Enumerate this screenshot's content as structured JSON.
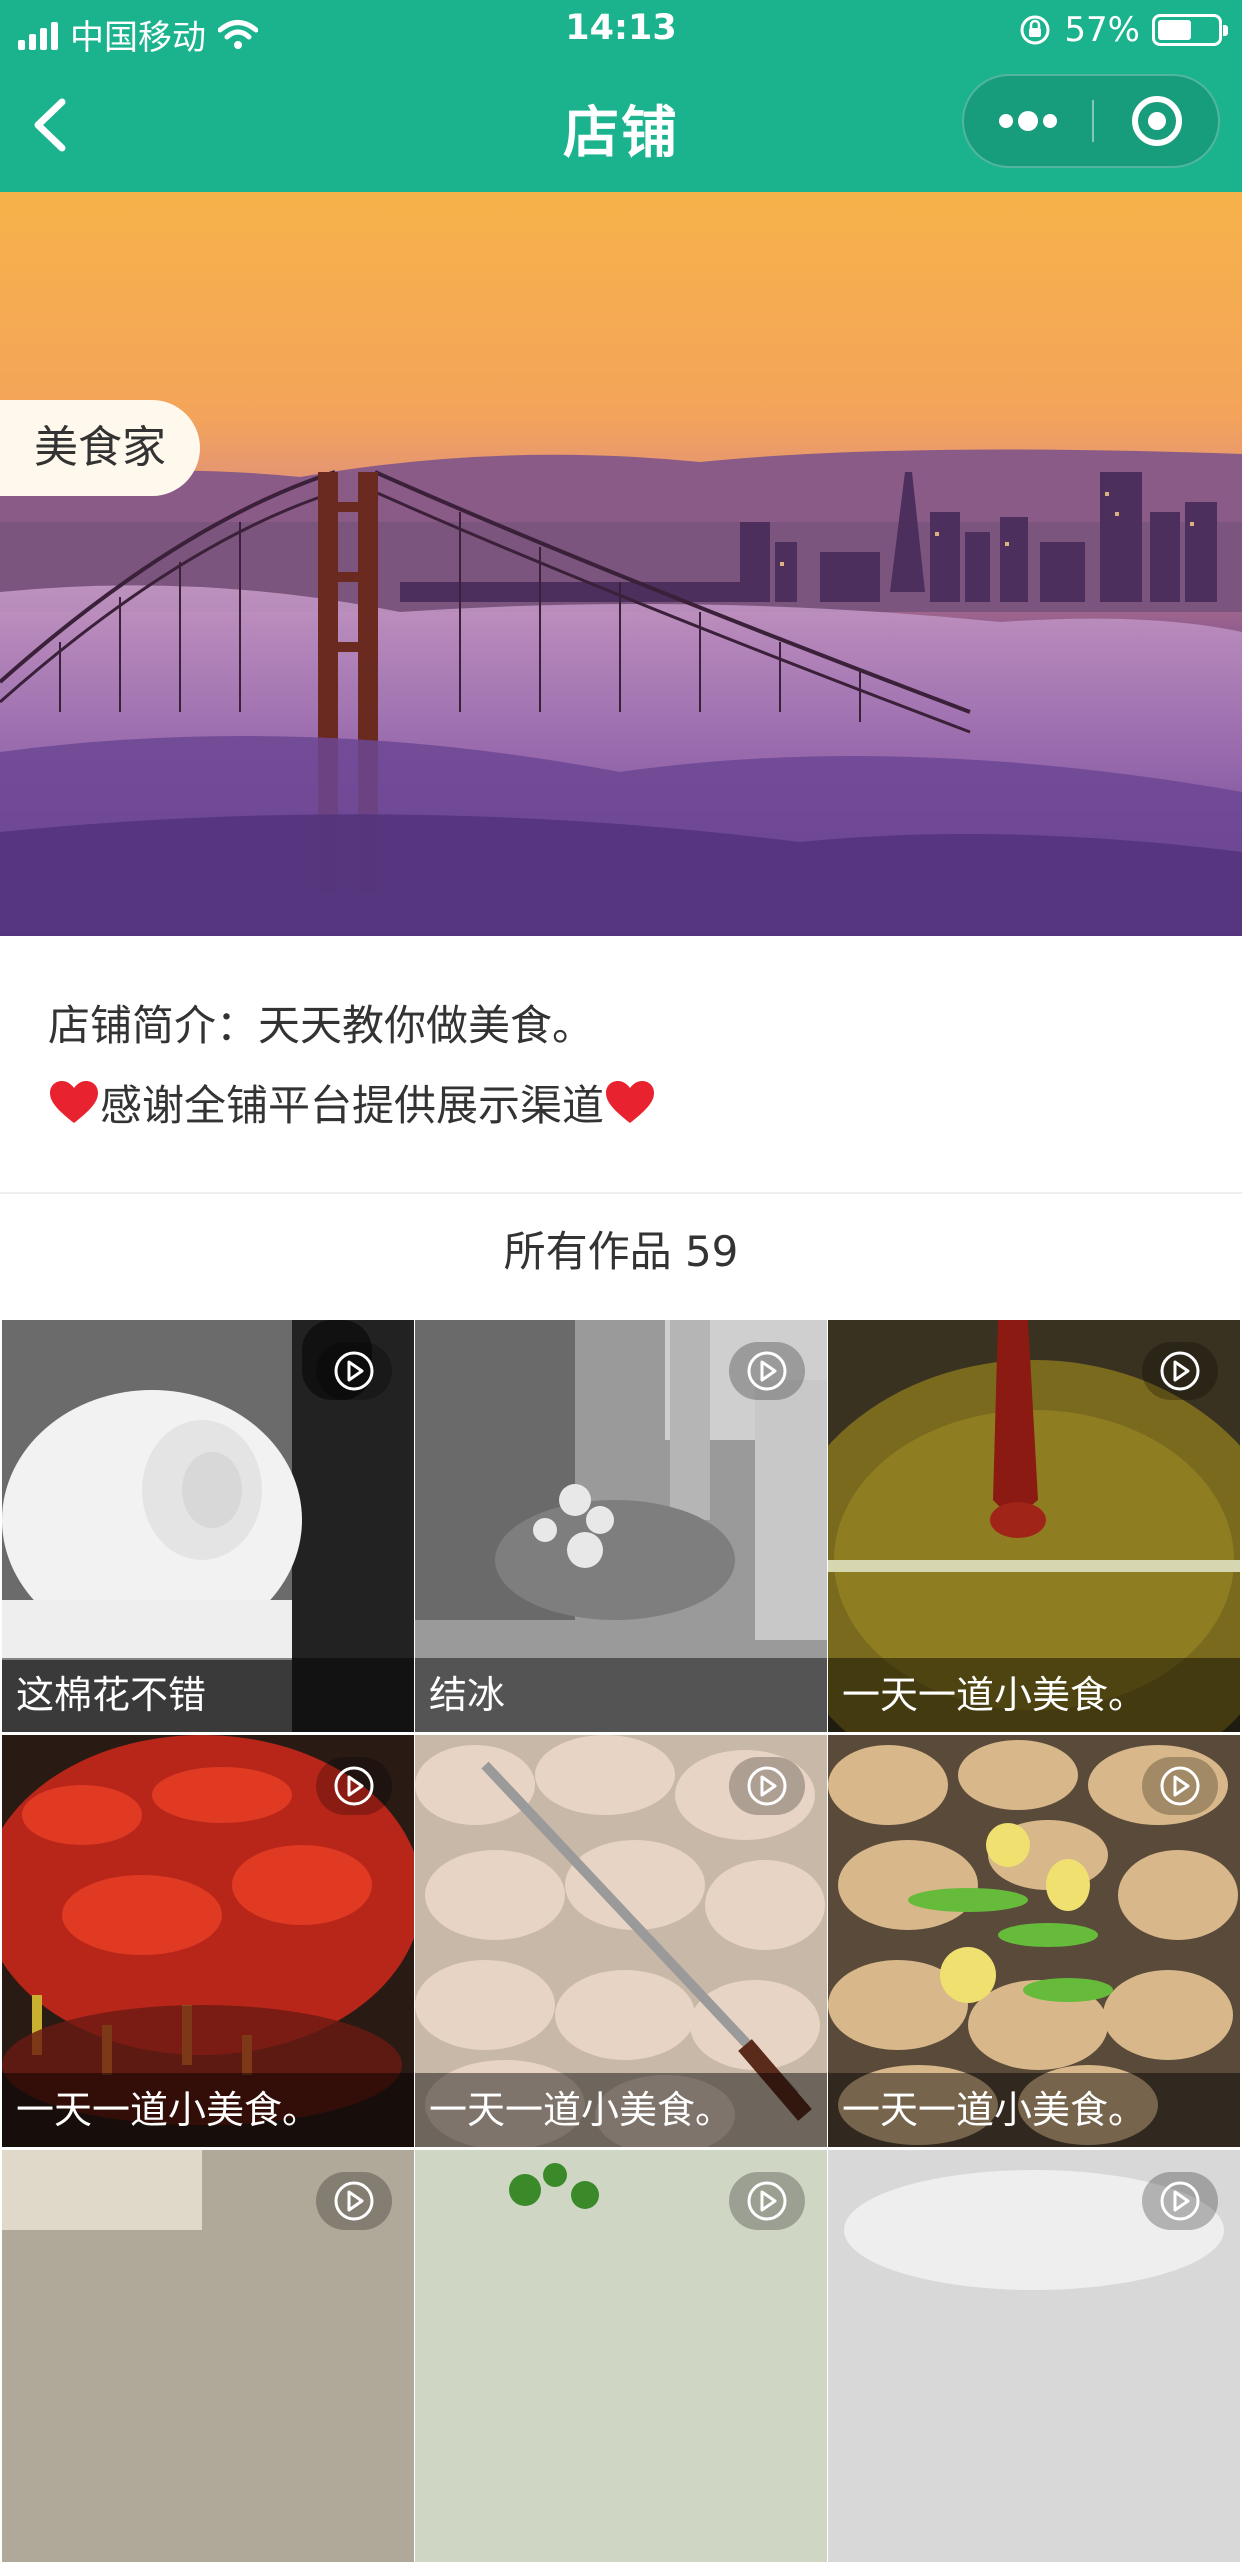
{
  "status": {
    "carrier": "中国移动",
    "time": "14:13",
    "battery": "57%",
    "battery_level": 0.57
  },
  "nav": {
    "title": "店铺",
    "back_icon": "chevron-left-icon",
    "more_icon": "more-dots-icon",
    "close_icon": "target-circle-icon"
  },
  "banner": {
    "tag": "美食家",
    "image": "golden-gate-bridge-fog-sunset"
  },
  "intro": {
    "line1": "店铺简介：天天教你做美食。",
    "line2": "感谢全铺平台提供展示渠道"
  },
  "works": {
    "title": "所有作品 59",
    "items": [
      {
        "caption": "这棉花不错",
        "image": "snow-roll"
      },
      {
        "caption": "结冰",
        "image": "ice-crushing"
      },
      {
        "caption": "一天一道小美食。",
        "image": "crayfish-oil"
      },
      {
        "caption": "一天一道小美食。",
        "image": "spicy-crayfish"
      },
      {
        "caption": "一天一道小美食。",
        "image": "chicken-wings-knife"
      },
      {
        "caption": "一天一道小美食。",
        "image": "chicken-wings-ginger"
      },
      {
        "caption": "",
        "image": "partial-1"
      },
      {
        "caption": "",
        "image": "partial-2"
      },
      {
        "caption": "",
        "image": "partial-3"
      }
    ]
  },
  "colors": {
    "primary": "#1bb38d",
    "text": "#333333"
  }
}
